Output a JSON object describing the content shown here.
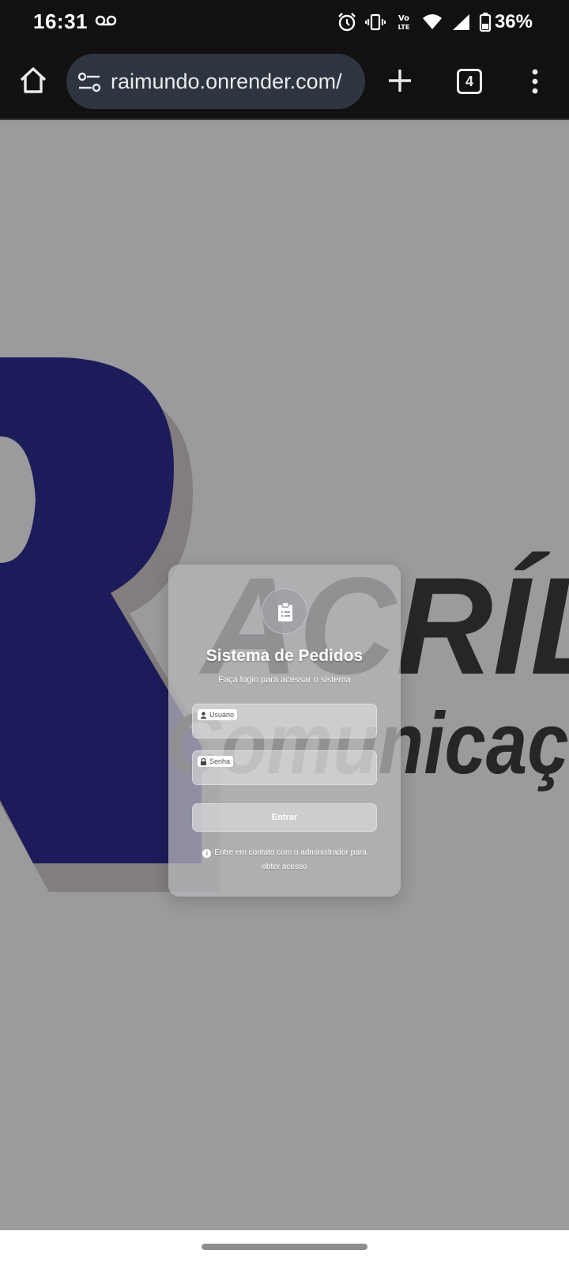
{
  "status_bar": {
    "time": "16:31",
    "battery": "36%",
    "icons": [
      "voicemail-icon",
      "alarm-icon",
      "vibrate-icon",
      "volte-icon",
      "wifi-icon",
      "signal-icon",
      "battery-icon"
    ]
  },
  "browser": {
    "url": "raimundo.onrender.com/",
    "tab_count": "4",
    "icons": [
      "home-icon",
      "site-settings-icon",
      "new-tab-icon",
      "tab-switcher-icon",
      "menu-icon"
    ]
  },
  "background_logo": {
    "text_line1": "ACRÍL",
    "text_line2": "Comunicaçã",
    "colors": {
      "navy": "#1c1c5a",
      "shadow": "#837e7e",
      "dark_text": "#262626"
    }
  },
  "login": {
    "title": "Sistema de Pedidos",
    "subtitle": "Faça login para acessar o sistema",
    "username_label": "Usuário",
    "password_label": "Senha",
    "submit_label": "Entrar",
    "note": "Entre em contato com o administrador para obter acesso",
    "icons": [
      "clipboard-icon",
      "user-icon",
      "lock-icon",
      "info-icon"
    ]
  },
  "colors": {
    "page_background": "#9b9b9d",
    "system_bars": "#111111",
    "url_bar": "#2f3540"
  }
}
